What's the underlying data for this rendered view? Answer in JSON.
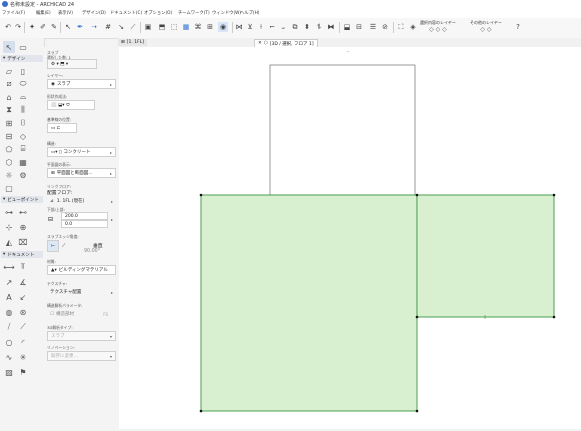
{
  "window": {
    "title": "名称未設定 - ARCHICAD 24"
  },
  "menu": [
    "ファイル(F)",
    "編集(E)",
    "表示(V)",
    "デザイン(D)",
    "ドキュメント(C)",
    "オプション(O)",
    "チームワーク(T)",
    "ウィンドウ(W)",
    "ヘルプ(H)"
  ],
  "toolbar": {
    "layer_current": "選択内容のレイヤー",
    "layer_other": "その他のレイヤー"
  },
  "tabs": [
    {
      "label": "[1. 1FL]",
      "active": false
    },
    {
      "label": "[3D / 選択, フロア 1]",
      "active": true
    }
  ],
  "toolbox": {
    "design_header": "デザイン",
    "viewpoint_header": "ビューポイント",
    "document_header": "ドキュメント"
  },
  "infobox": {
    "slab_label": "スラブ",
    "select_count_label": "選択した数: 1",
    "layer_label": "レイヤー:",
    "layer_value": "スラブ",
    "geometry_label": "形状作成法:",
    "reference_label": "基準線の位置:",
    "structure_label": "構造:",
    "structure_value": "コンクリート",
    "floorplan_label": "平面図の表示:",
    "floorplan_value": "平面図と断面図...",
    "home_story_label": "リンクフロア:",
    "home_story_title": "配置フロア:",
    "home_story_value": "1. 1FL (現在)",
    "offset_label": "下部/上部:",
    "thickness_value": "200.0",
    "offset_value": "0.0",
    "edge_label": "スラブエッジ角度:",
    "edge_type": "垂直",
    "edge_angle": "90.00°",
    "material_label": "材質:",
    "material_value": "ビルディングマテリアル",
    "texture_label": "テクスチャ:",
    "texture_value": "テクスチャ配置",
    "structural_label": "構造解析パラメータ:",
    "structural_value": "構造部材",
    "structural_badge": "FS",
    "classification_label": "3D解析タイプ:",
    "classification_value": "スラブ",
    "renovation_label": "リノベーション:",
    "renovation_value": "既存に変更..."
  },
  "colors": {
    "accent": "#3d7bd9",
    "slab_fill": "#d8f0d0",
    "slab_stroke": "#3b9640"
  }
}
